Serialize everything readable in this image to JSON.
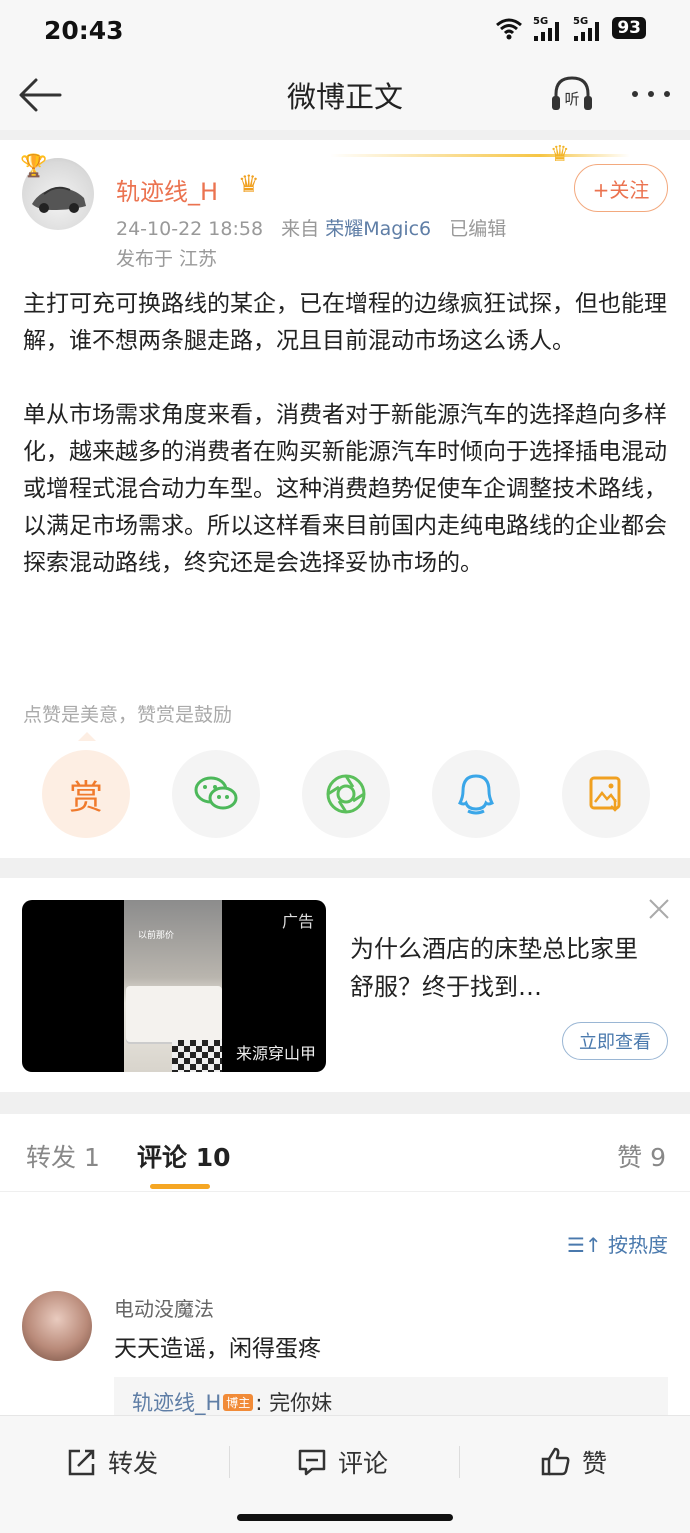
{
  "status_bar": {
    "time": "20:43",
    "network1": "5G",
    "network2": "5G",
    "battery": "93"
  },
  "nav": {
    "title": "微博正文",
    "listen_label": "听"
  },
  "post": {
    "author": "轨迹线_H",
    "timestamp": "24-10-22 18:58",
    "from_prefix": "来自",
    "source": "荣耀Magic6",
    "edited": "已编辑",
    "location": "发布于 江苏",
    "follow_label": "+关注",
    "paragraphs": [
      "主打可充可换路线的某企，已在增程的边缘疯狂试探，但也能理解，谁不想两条腿走路，况且目前混动市场这么诱人。",
      "单从市场需求角度来看，消费者对于新能源汽车的选择趋向多样化，越来越多的消费者在购买新能源汽车时倾向于选择插电混动或增程式混合动力车型。这种消费趋势促使车企调整技术路线，以满足市场需求。所以这样看来目前国内走纯电路线的企业都会探索混动路线，终究还是会选择妥协市场的。"
    ],
    "reward_hint": "点赞是美意，赞赏是鼓励",
    "reward_label": "赏",
    "share_icons": [
      "wechat-icon",
      "moments-icon",
      "qq-icon",
      "save-image-icon"
    ]
  },
  "ad": {
    "tag": "广告",
    "thumb_caption": "以前那价",
    "source": "来源穿山甲",
    "title": "为什么酒店的床垫总比家里舒服？终于找到…",
    "button": "立即查看"
  },
  "tabs": {
    "repost": "转发 1",
    "comment": "评论 10",
    "like": "赞 9"
  },
  "comments": {
    "sort_label": "按热度",
    "items": [
      {
        "user": "电动没魔法",
        "text": "天天造谣，闲得蛋疼",
        "reply_user": "轨迹线_H",
        "reply_tag": "博主",
        "reply_text": ": 完你妹"
      }
    ]
  },
  "bottom_bar": {
    "repost": "转发",
    "comment": "评论",
    "like": "赞"
  },
  "colors": {
    "accent": "#eb7350",
    "link": "#5f7ea6",
    "tab_indicator": "#f5a623"
  }
}
